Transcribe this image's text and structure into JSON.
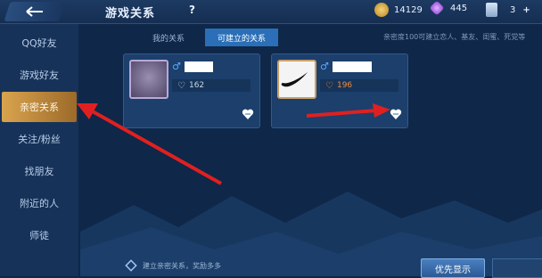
{
  "header": {
    "title": "游戏关系",
    "help_label": "?",
    "gold_value": "14129",
    "gem_value": "445",
    "ticket_value": "3"
  },
  "sidebar": {
    "items": [
      {
        "label": "QQ好友"
      },
      {
        "label": "游戏好友"
      },
      {
        "label": "亲密关系"
      },
      {
        "label": "关注/粉丝"
      },
      {
        "label": "找朋友"
      },
      {
        "label": "附近的人"
      },
      {
        "label": "师徒"
      }
    ],
    "active_index": 2
  },
  "tabs": [
    {
      "label": "我的关系"
    },
    {
      "label": "可建立的关系"
    }
  ],
  "hint_text": "亲密度100可建立恋人、基友、闺蜜、死党等",
  "cards": [
    {
      "gender": "♂",
      "intimacy": "162",
      "heart_color": "#c9d6e6",
      "value_color": "#c9d6e6"
    },
    {
      "gender": "♂",
      "intimacy": "196",
      "heart_color": "#f08a3c",
      "value_color": "#f08a3c"
    }
  ],
  "bottom_hint": "建立亲密关系，奖励多多",
  "priority_button": "优先显示",
  "colors": {
    "accent_tab": "#2a6fb8",
    "active_side": "#d9a44e",
    "annotation_arrow": "#e02020"
  }
}
